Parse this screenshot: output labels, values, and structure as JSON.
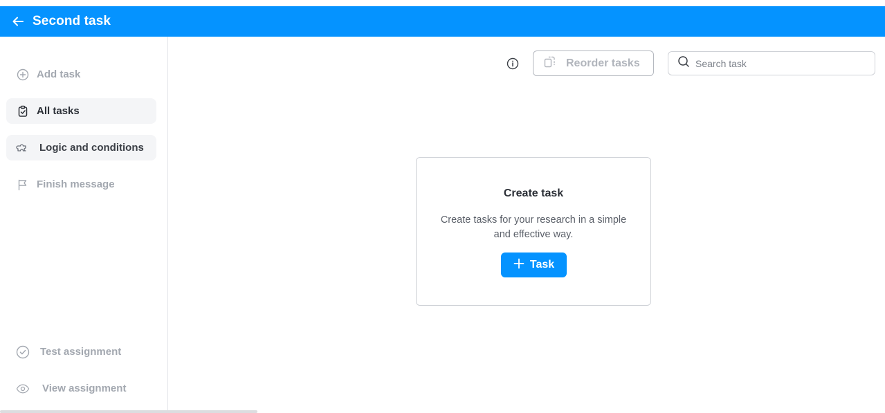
{
  "header": {
    "title": "Second task",
    "back_icon": "arrow-left-icon",
    "color": "#0593ff"
  },
  "sidebar": {
    "items": [
      {
        "label": "Add task",
        "icon": "plus-circle-icon"
      },
      {
        "label": "All tasks",
        "icon": "clipboard-check-icon",
        "active": true
      },
      {
        "label": "Logic and conditions",
        "icon": "puzzle-icon",
        "active": true
      },
      {
        "label": "Finish message",
        "icon": "flag-icon"
      }
    ],
    "bottom_items": [
      {
        "label": "Test assignment",
        "icon": "check-circle-icon"
      },
      {
        "label": "View assignment",
        "icon": "eye-icon"
      }
    ]
  },
  "toolbar": {
    "info_icon": "info-icon",
    "reorder_label": "Reorder tasks",
    "search_placeholder": "Search task"
  },
  "empty_state": {
    "title": "Create task",
    "description": "Create tasks for your research in a simple and effective way.",
    "button_label": "Task"
  },
  "colors": {
    "accent": "#0593ff",
    "muted_text": "#a3a8b0"
  }
}
